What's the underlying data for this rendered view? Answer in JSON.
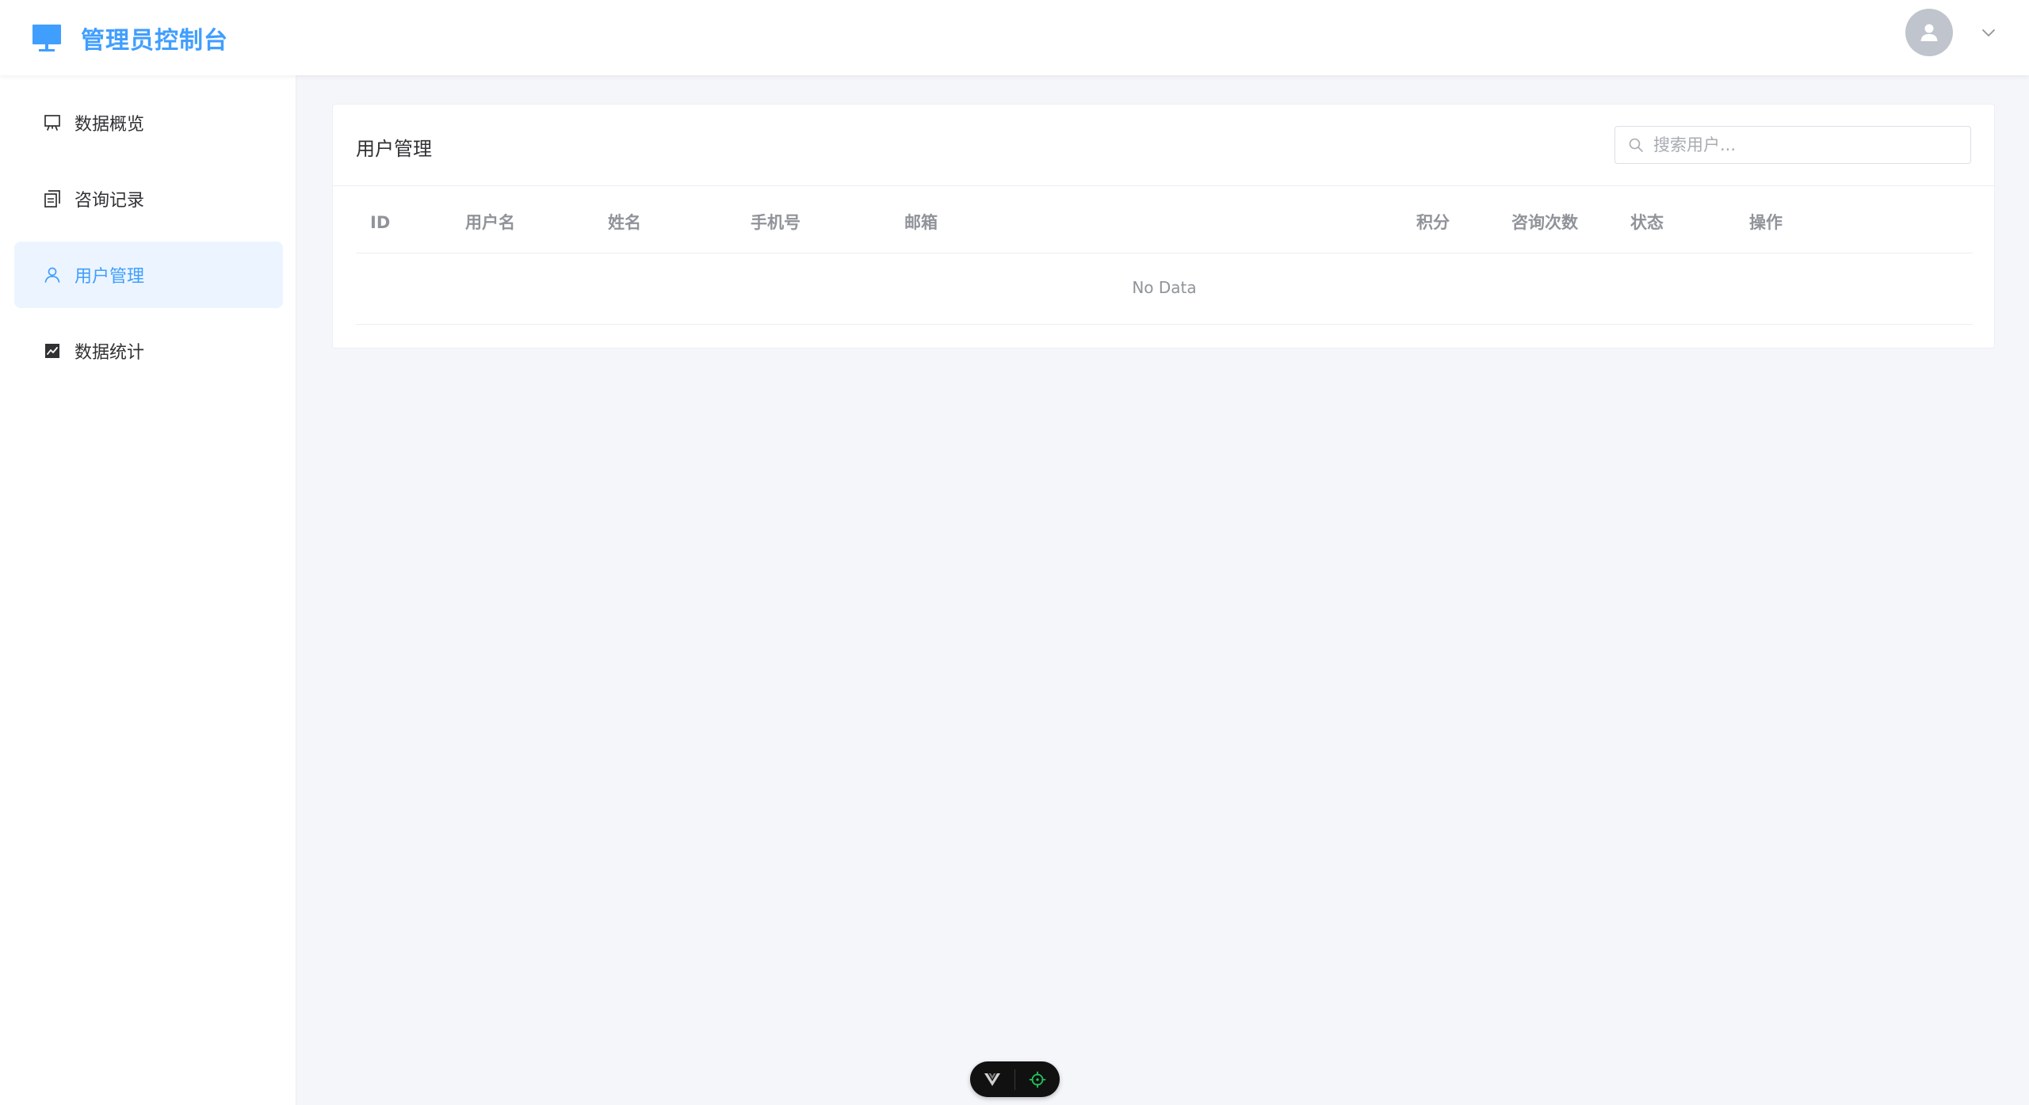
{
  "header": {
    "app_title": "管理员控制台",
    "brand_color": "#409eff"
  },
  "sidebar": {
    "items": [
      {
        "label": "数据概览",
        "icon": "presentation-board-icon",
        "active": false
      },
      {
        "label": "咨询记录",
        "icon": "copy-document-icon",
        "active": false
      },
      {
        "label": "用户管理",
        "icon": "user-icon",
        "active": true
      },
      {
        "label": "数据统计",
        "icon": "line-chart-icon",
        "active": false
      }
    ]
  },
  "main": {
    "card_title": "用户管理",
    "search": {
      "placeholder": "搜索用户...",
      "value": ""
    },
    "table": {
      "columns": [
        "ID",
        "用户名",
        "姓名",
        "手机号",
        "邮箱",
        "积分",
        "咨询次数",
        "状态",
        "操作"
      ],
      "rows": [],
      "empty_text": "No Data"
    }
  },
  "colors": {
    "accent": "#409eff",
    "active_bg": "#ecf5ff",
    "main_bg": "#f5f6fa",
    "muted_text": "#909399"
  }
}
